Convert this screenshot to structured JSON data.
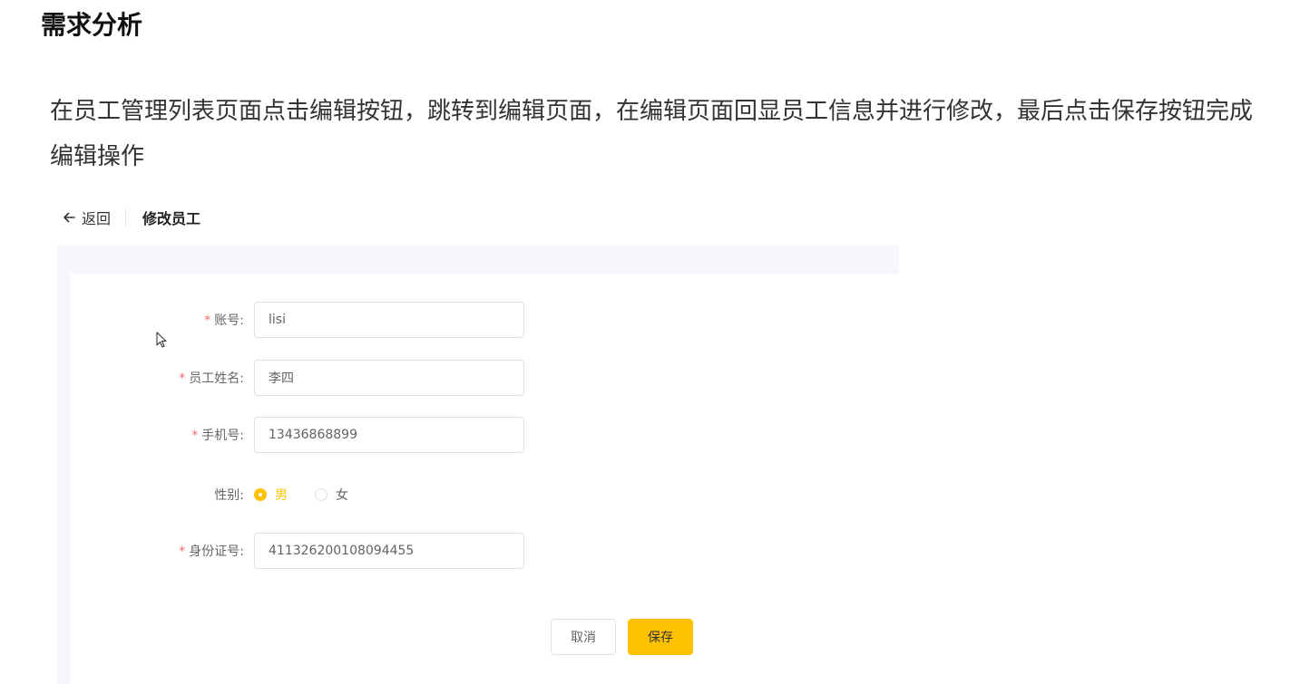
{
  "doc": {
    "title": "需求分析",
    "description": "在员工管理列表页面点击编辑按钮，跳转到编辑页面，在编辑页面回显员工信息并进行修改，最后点击保存按钮完成编辑操作"
  },
  "header": {
    "back_label": "返回",
    "page_title": "修改员工"
  },
  "form": {
    "account": {
      "required": "*",
      "label": "账号:",
      "value": "lisi"
    },
    "name": {
      "required": "*",
      "label": "员工姓名:",
      "value": "李四"
    },
    "phone": {
      "required": "*",
      "label": "手机号:",
      "value": "13436868899"
    },
    "gender": {
      "label": "性别:",
      "options": [
        {
          "label": "男",
          "checked": true
        },
        {
          "label": "女",
          "checked": false
        }
      ]
    },
    "id_number": {
      "required": "*",
      "label": "身份证号:",
      "value": "411326200108094455"
    }
  },
  "actions": {
    "cancel_label": "取消",
    "save_label": "保存"
  },
  "colors": {
    "accent": "#ffc200",
    "required": "#f56c6c",
    "panel_bg": "#f6f6fb"
  }
}
